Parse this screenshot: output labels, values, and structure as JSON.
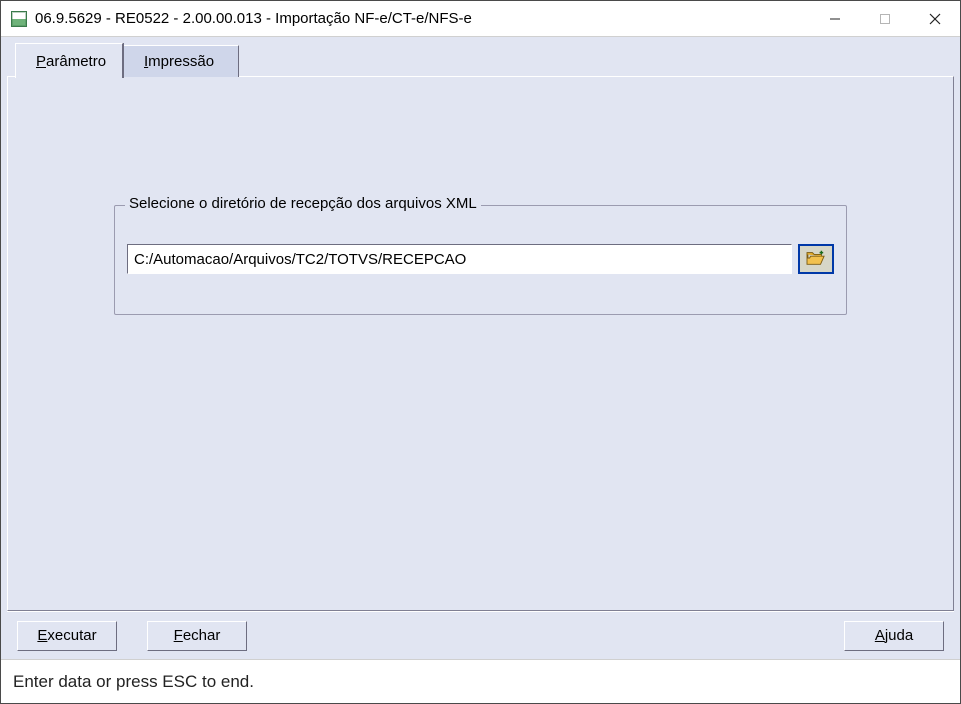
{
  "window": {
    "title": "06.9.5629 - RE0522 - 2.00.00.013 - Importação NF-e/CT-e/NFS-e"
  },
  "tabs": {
    "parametro": {
      "accel": "P",
      "rest": "arâmetro"
    },
    "impressao": {
      "accel": "I",
      "rest": "mpressão"
    }
  },
  "groupbox": {
    "label": "Selecione o diretório de recepção dos arquivos XML",
    "path": "C:/Automacao/Arquivos/TC2/TOTVS/RECEPCAO"
  },
  "buttons": {
    "executar": {
      "accel": "E",
      "rest": "xecutar"
    },
    "fechar": {
      "accel": "F",
      "rest": "echar"
    },
    "ajuda": {
      "accel": "A",
      "rest": "juda"
    }
  },
  "status": "Enter data or press ESC to end."
}
